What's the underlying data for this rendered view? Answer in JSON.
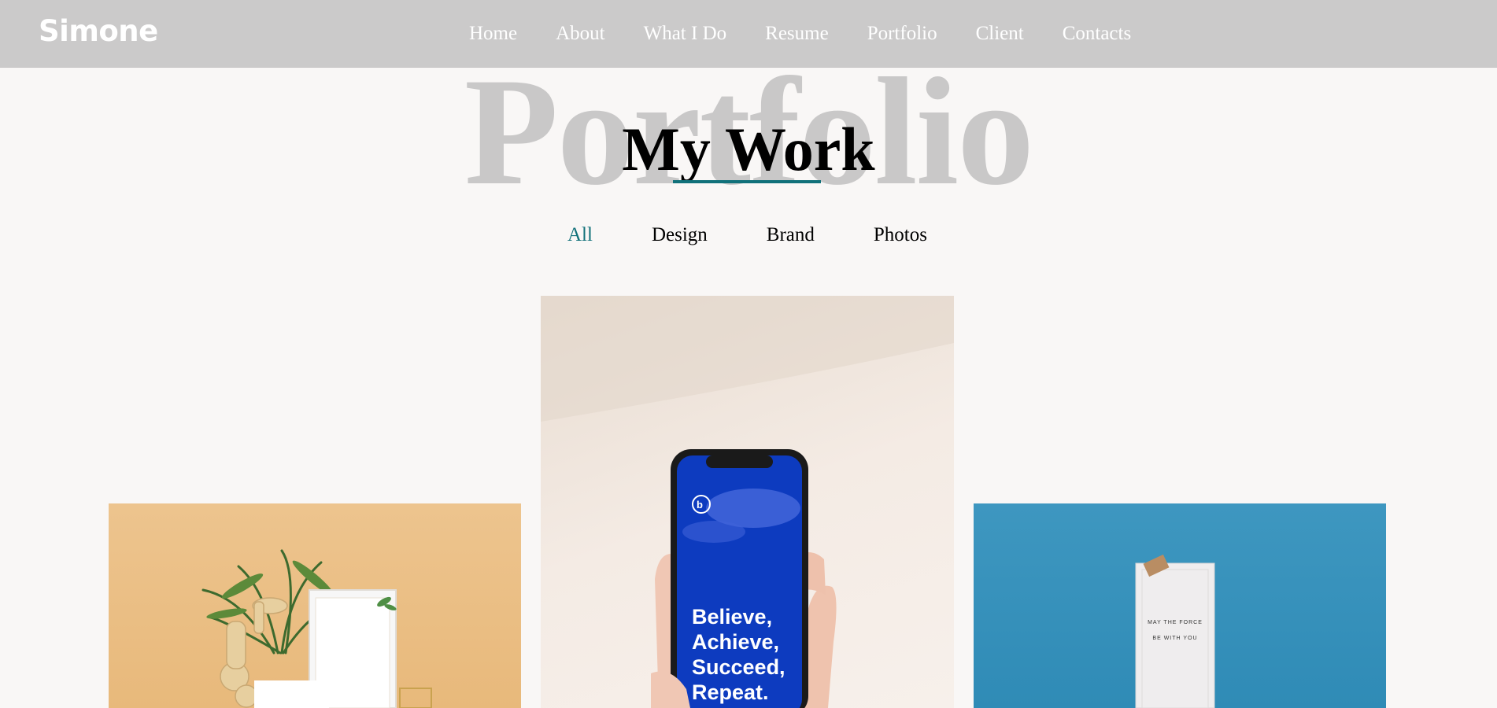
{
  "site": {
    "logo": "Simone"
  },
  "nav": {
    "items": [
      {
        "label": "Home"
      },
      {
        "label": "About"
      },
      {
        "label": "What I Do"
      },
      {
        "label": "Resume"
      },
      {
        "label": "Portfolio"
      },
      {
        "label": "Client"
      },
      {
        "label": "Contacts"
      }
    ]
  },
  "section": {
    "background_title": "Portfolio",
    "title": "My Work",
    "accent_color": "#11717a"
  },
  "filters": {
    "items": [
      {
        "label": "All",
        "active": true
      },
      {
        "label": "Design",
        "active": false
      },
      {
        "label": "Brand",
        "active": false
      },
      {
        "label": "Photos",
        "active": false
      }
    ]
  },
  "portfolio": {
    "items": [
      {
        "image": "plant-and-card-photo"
      },
      {
        "image": "phone-in-hand-photo",
        "screen_text": [
          "Believe,",
          "Achieve,",
          "Succeed,",
          "Repeat."
        ]
      },
      {
        "image": "note-on-blue-wall-photo",
        "note_text": [
          "MAY THE FORCE",
          "BE WITH YOU"
        ]
      }
    ]
  }
}
